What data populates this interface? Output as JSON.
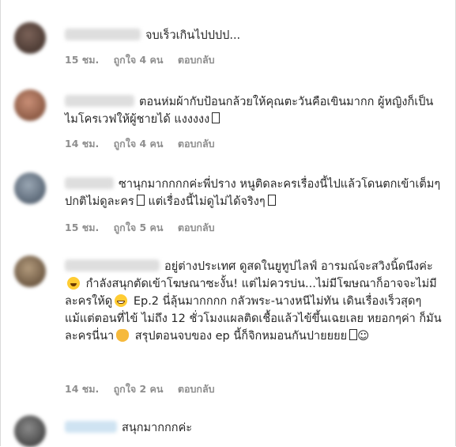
{
  "comments": [
    {
      "text": "จบเร็วเกินไปปปป...",
      "time": "15 ชม.",
      "likes": "ถูกใจ 4 คน",
      "reply": "ตอบกลับ"
    },
    {
      "text": "ตอนห่มผ้ากับป้อนกล้วยให้คุณตะวันคือเขินมากก ผู้หญิงก็เป็นไมโครเวฟให้ผู้ชายได้ แงงงงง",
      "time": "14 ชม.",
      "likes": "ถูกใจ 4 คน",
      "reply": "ตอบกลับ"
    },
    {
      "text_a": "ซานุกมากกกกค่ะพี่ปราง หนูติดละครเรื่องนี้ไปแล้วโดนตกเข้าเต็มๆ ปกติไม่ดูละคร",
      "text_b": " แต่เรื่องนี้ไม่ดูไม่ได้จริงๆ",
      "time": "15 ชม.",
      "likes": "ถูกใจ 5 คน",
      "reply": "ตอบกลับ"
    },
    {
      "text_a": "อยู่ต่างประเทศ ดูสดในยูทูปไลฟ์ อารมณ์จะสวิงนิ้ดนึงค่ะ",
      "text_b": " กำลังสนุกตัดเข้าโฆษณาซะงั้น! แต่ไม่ควรบ่น...ไม่มีโฆษณาก็อาจจะไม่มีละครให้ดู",
      "text_c": " Ep.2 นี่ลุ้นมากกกก กลัวพระ-นางหนีไม่ทัน เดินเรื่องเร็วสุดๆแม้แต่ตอนที่ไข้ ไม่ถึง 12 ชั่วโมงแผลติดเชื้อแล้วไข้ขึ้นเฉยเลย หยอกๆค่า ก็มันละครนี่นา",
      "text_d": " สรุปตอนจบของ ep นี้ก็จิกหมอนกันปายยยย",
      "smile": "☺",
      "time": "14 ชม.",
      "likes": "ถูกใจ 2 คน",
      "reply": "ตอบกลับ"
    },
    {
      "text": "สนุกมากกกค่ะ"
    }
  ],
  "colors": {
    "text": "#262626",
    "meta": "#8e8e8e",
    "laugh_emoji": "#ffcc33",
    "clap_emoji": "#f6b93b"
  }
}
